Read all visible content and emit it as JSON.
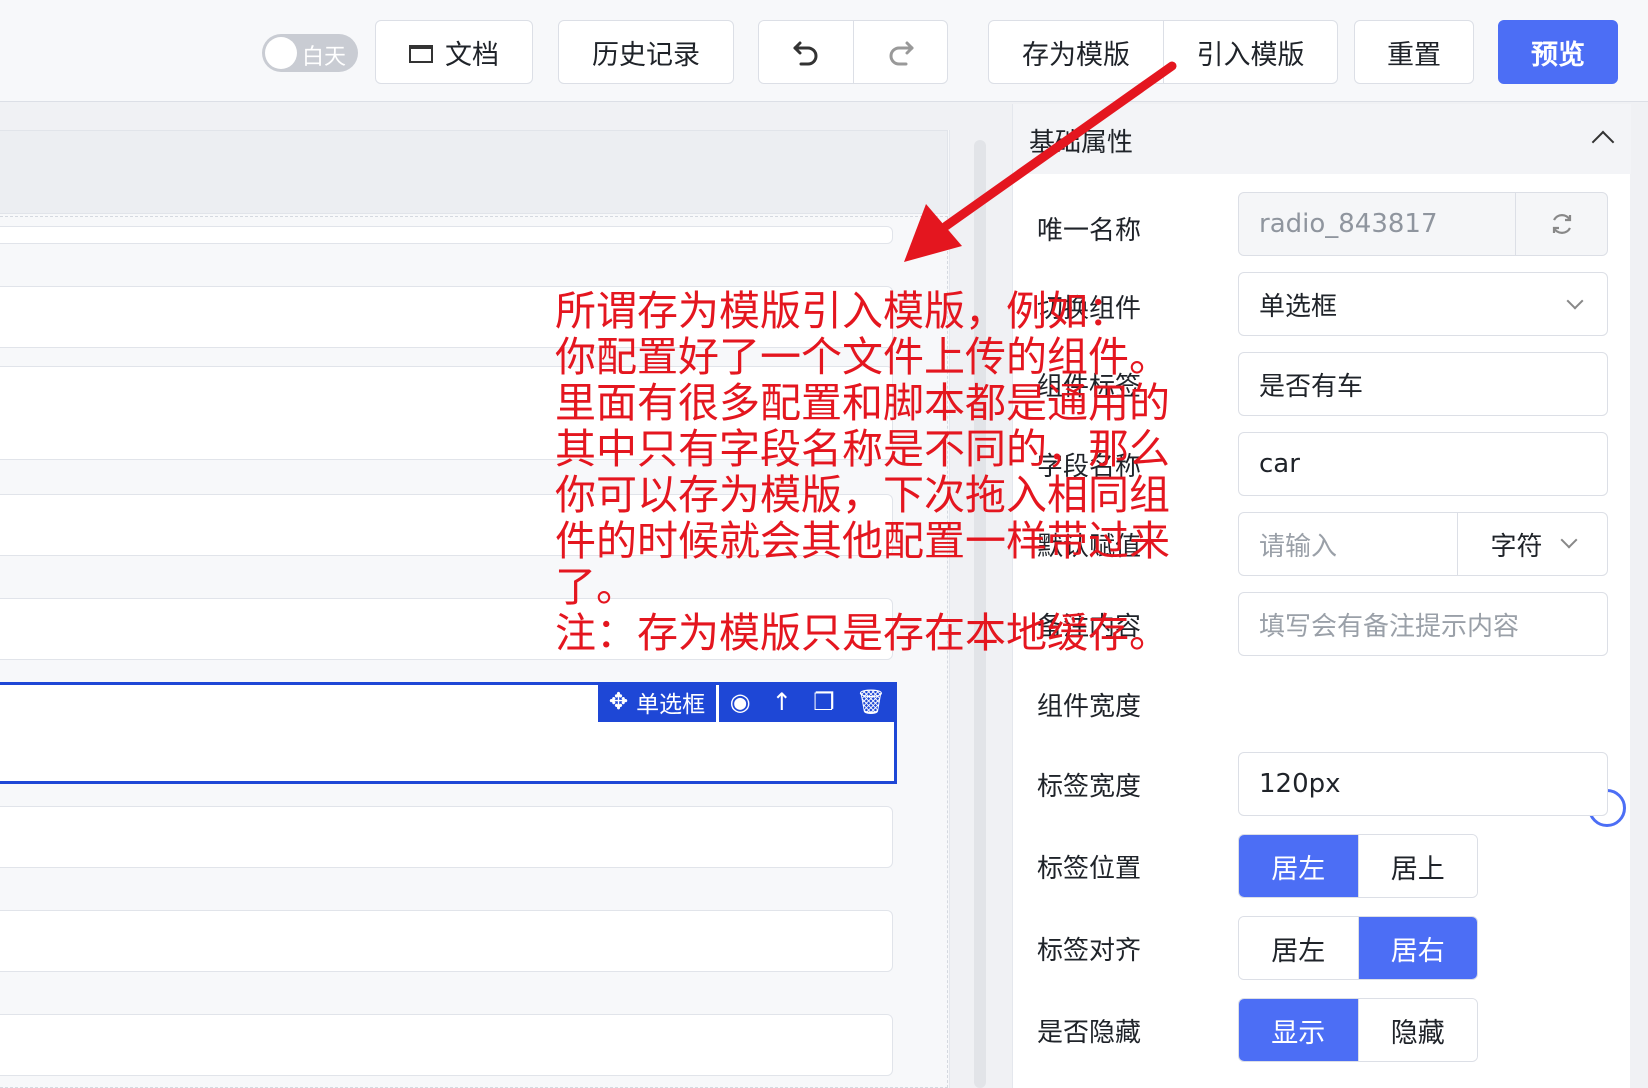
{
  "header": {
    "theme_toggle": "白天",
    "doc_label": "文档",
    "history_label": "历史记录",
    "undo_icon": "undo-icon",
    "redo_icon": "redo-icon",
    "save_template_label": "存为模版",
    "import_template_label": "引入模版",
    "reset_label": "重置",
    "preview_label": "预览",
    "accent": "#4c6ef5"
  },
  "canvas": {
    "selected_component_label": "单选框",
    "selection_color": "#1e47d6"
  },
  "panel": {
    "title": "基础属性",
    "fields": {
      "unique_name_label": "唯一名称",
      "unique_name_value": "radio_843817",
      "switch_component_label": "切换组件",
      "switch_component_value": "单选框",
      "component_label_label": "组件标签",
      "component_label_value": "是否有车",
      "field_name_label": "字段名称",
      "field_name_value": "car",
      "default_value_label": "默认赋值",
      "default_value_placeholder": "请输入",
      "default_value_type": "字符",
      "remark_label": "备注内容",
      "remark_placeholder": "填写会有备注提示内容",
      "width_label": "组件宽度",
      "width_value_fraction": 1.0,
      "label_width_label": "标签宽度",
      "label_width_value": "120px",
      "label_position_label": "标签位置",
      "label_position_options": [
        "居左",
        "居上"
      ],
      "label_position_selected": "居左",
      "label_align_label": "标签对齐",
      "label_align_options": [
        "居左",
        "居右"
      ],
      "label_align_selected": "居右",
      "hidden_label": "是否隐藏",
      "hidden_options": [
        "显示",
        "隐藏"
      ],
      "hidden_selected": "显示"
    }
  },
  "annotation": {
    "color": "#e4161f",
    "lines": [
      "所谓存为模版引入模版，例如：",
      "你配置好了一个文件上传的组件。",
      "里面有很多配置和脚本都是通用的",
      "其中只有字段名称是不同的，那么",
      "你可以存为模版，下次拖入相同组",
      "件的时候就会其他配置一样带过来",
      "了。",
      "注：存为模版只是存在本地缓存。"
    ]
  }
}
